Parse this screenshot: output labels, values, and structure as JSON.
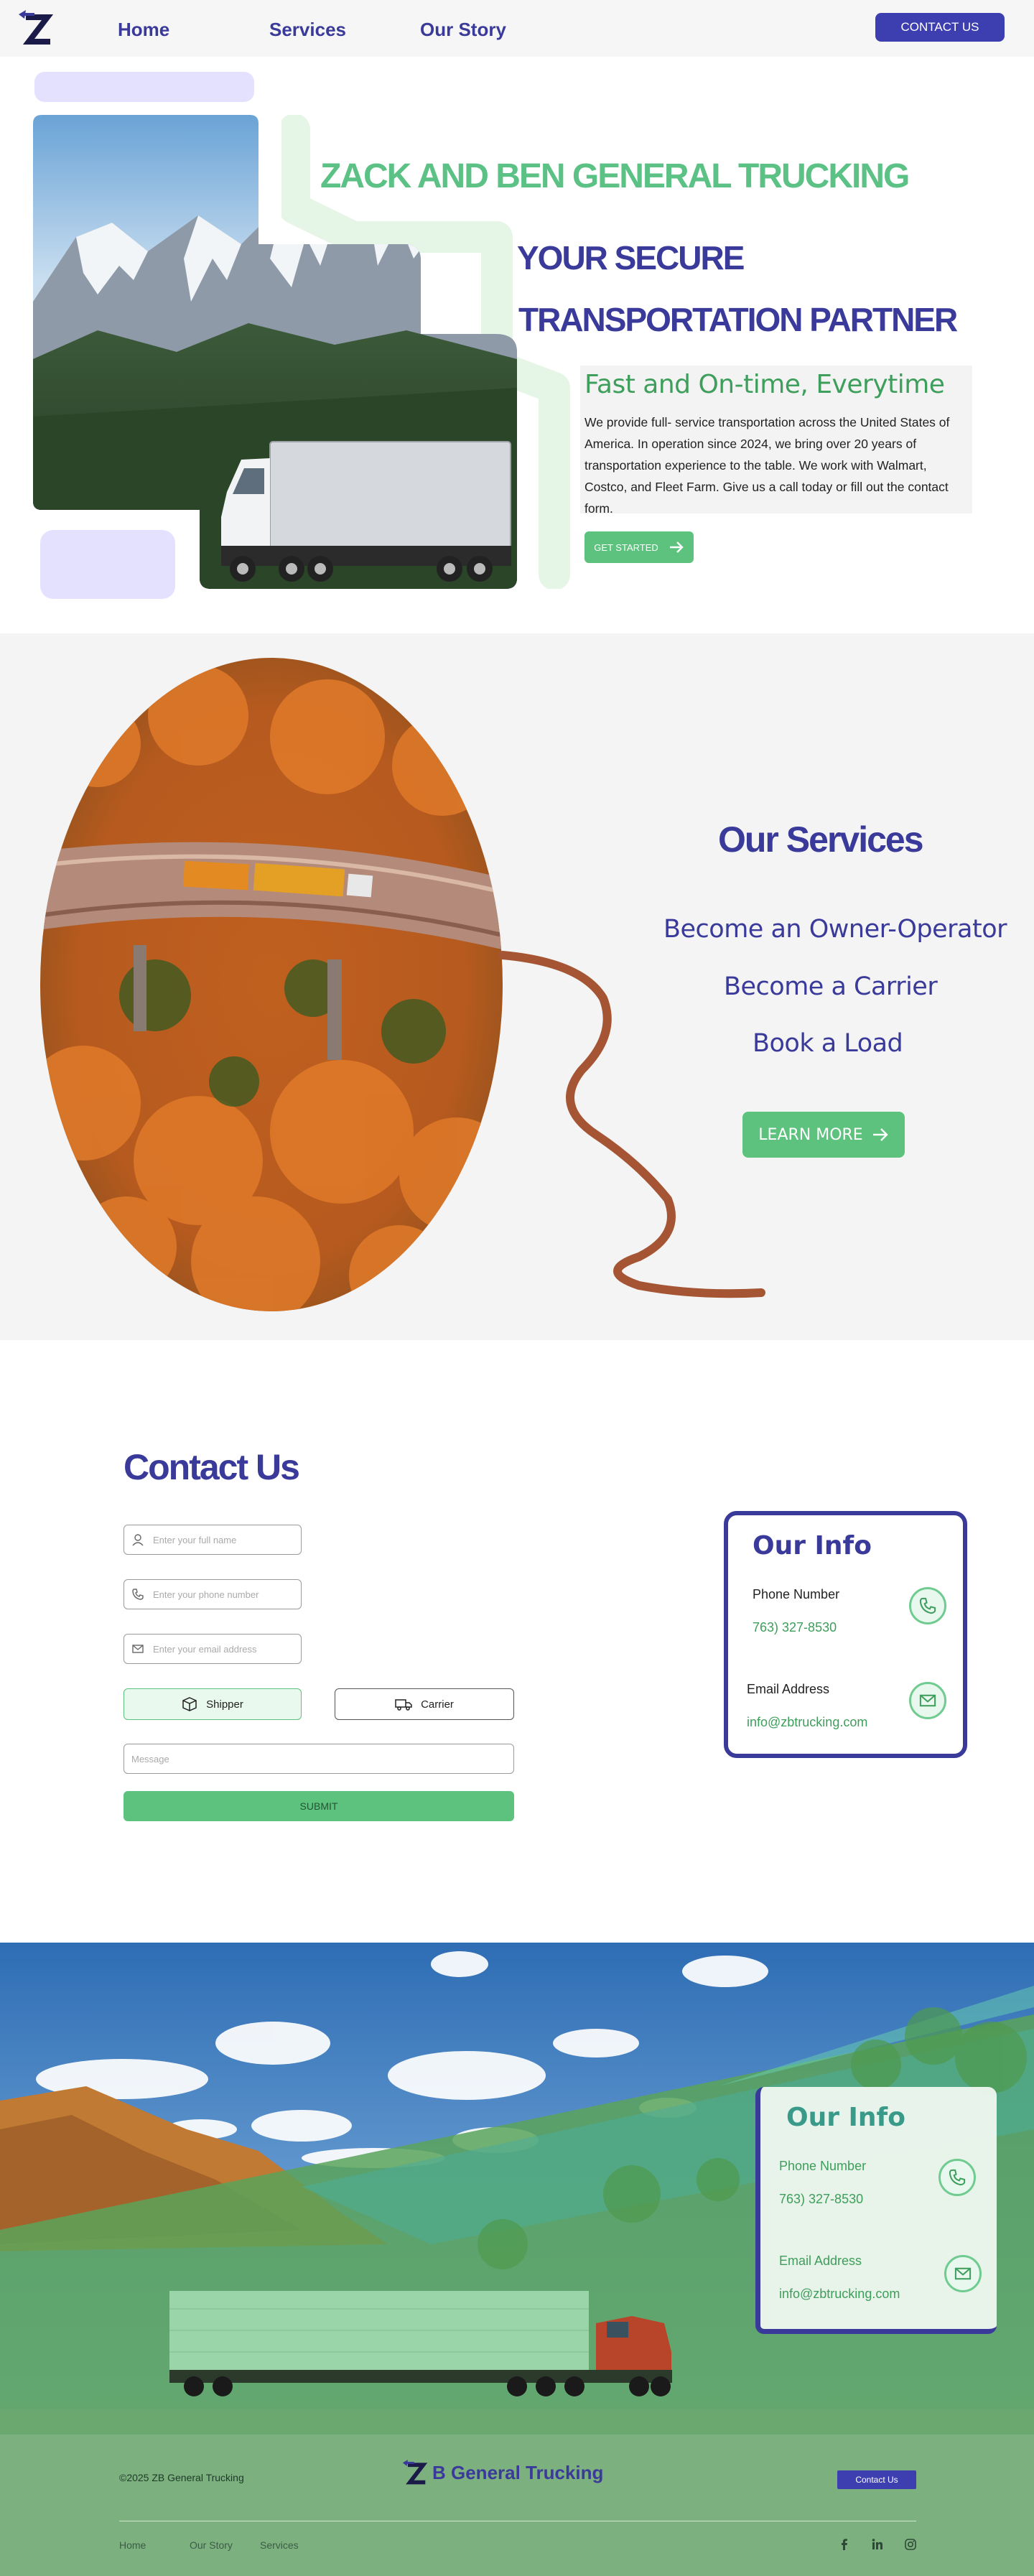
{
  "nav": {
    "logo_icon": "zb-logo-icon",
    "links": [
      "Home",
      "Services",
      "Our Story"
    ],
    "contact_button": "CONTACT US"
  },
  "hero": {
    "title": "ZACK AND BEN GENERAL TRUCKING",
    "subtitle_line1": "YOUR SECURE",
    "subtitle_line2": "TRANSPORTATION PARTNER",
    "tagline": "Fast and On-time, Everytime",
    "description": "We provide full- service transportation across the United States of America. In operation since 2024, we bring over 20 years of transportation experience to the table. We work with Walmart, Costco, and Fleet Farm. Give us a call today or fill out the contact form.",
    "cta_button": "GET STARTED",
    "cta_icon": "arrow-right-icon",
    "image": "mountain-semi-truck-photo"
  },
  "services": {
    "title": "Our Services",
    "items": [
      "Become an Owner-Operator",
      "Become a Carrier",
      "Book a Load"
    ],
    "button": "LEARN MORE",
    "image": "autumn-forest-bridge-truck-photo"
  },
  "contact": {
    "title": "Contact Us",
    "fields": {
      "name_placeholder": "Enter your full name",
      "phone_placeholder": "Enter your phone number",
      "email_placeholder": "Enter your email address",
      "message_placeholder": "Message"
    },
    "roles": [
      "Shipper",
      "Carrier"
    ],
    "submit": "SUBMIT",
    "info": {
      "title": "Our Info",
      "phone_label": "Phone Number",
      "phone": "763) 327-8530",
      "email_label": "Email Address",
      "email": "info@zbtrucking.com"
    }
  },
  "footer": {
    "image": "desert-highway-truck-photo",
    "info": {
      "title": "Our Info",
      "phone_label": "Phone Number",
      "phone": "763) 327-8530",
      "email_label": "Email Address",
      "email": "info@zbtrucking.com"
    },
    "copyright": "©2025 ZB General Trucking",
    "brand": "B General Trucking",
    "contact_button": "Contact Us",
    "links": [
      "Home",
      "Our Story",
      "Services"
    ],
    "social_icons": [
      "facebook-icon",
      "linkedin-icon",
      "instagram-icon"
    ]
  },
  "colors": {
    "brand_blue": "#3a3a9a",
    "brand_green": "#5cc27d",
    "lavender": "#e4e1ff",
    "rust": "#a55533"
  }
}
